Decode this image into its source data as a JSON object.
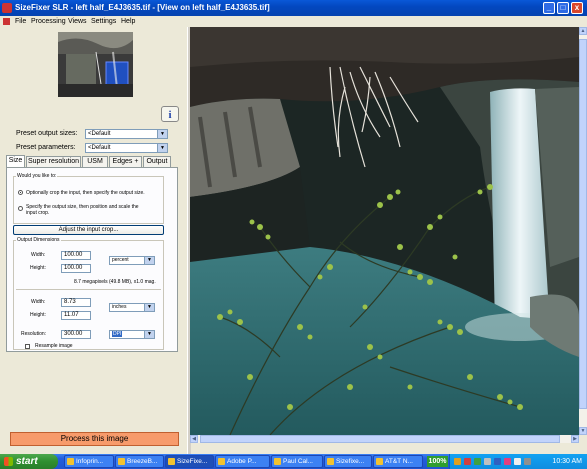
{
  "window": {
    "title": "SizeFixer SLR - left half_E4J3635.tif - [View on left half_E4J3635.tif]",
    "min_label": "_",
    "max_label": "□",
    "close_label": "x"
  },
  "menu": [
    "File",
    "Processing",
    "Views",
    "Settings",
    "Help"
  ],
  "info_button": "i",
  "preset_output_sizes": {
    "label": "Preset output sizes:",
    "value": "<Default"
  },
  "preset_parameters": {
    "label": "Preset parameters:",
    "value": "<Default"
  },
  "tabs": [
    "Size",
    "Super resolution",
    "USM",
    "Edges +",
    "Output"
  ],
  "active_tab": "Size",
  "size_tab": {
    "question": "Would you like to:",
    "option1": "Optionally crop the input, then specify the output size.",
    "option2_line1": "Specify the output size, then position and scale the",
    "option2_line2": "input crop.",
    "adjust_button": "Adjust the input crop...",
    "output_dimensions_label": "Output Dimensions",
    "width_label": "Width:",
    "width_value": "100.00",
    "height_label": "Height:",
    "height_value": "100.00",
    "units1": "percent",
    "megapixels": "8.7 megapixels (49.8 MB), x1.0 mag.",
    "width2_label": "Width:",
    "width2_value": "8.73",
    "height2_label": "Height:",
    "height2_value": "11.07",
    "units2": "inches",
    "resolution_label": "Resolution:",
    "resolution_value": "300.00",
    "resolution_units": "DPI",
    "resample_label": "Resample image"
  },
  "process_button": "Process this image",
  "scroll": {
    "up": "▲",
    "down": "▼",
    "left": "◀",
    "right": "▶"
  },
  "taskbar": {
    "start": "start",
    "buttons": [
      "Infoprin...",
      "BreezeB...",
      "SizeFixe...",
      "Adobe P...",
      "Paul Cal...",
      "Sizefixe...",
      "AT&T N..."
    ],
    "active_index": 2,
    "zoom": "100%",
    "clock": "10:30 AM"
  },
  "colors": {
    "titlebar": "#0A58D8",
    "process_button": "#F79B6B",
    "taskbar": "#245EDC",
    "start": "#2F8F2F",
    "water": "#2F6E72",
    "foliage": "#9CC24A"
  },
  "icons": [
    "app-icon",
    "info-icon",
    "windows-flag-icon",
    "shield-icon",
    "speaker-icon",
    "network-icon"
  ]
}
